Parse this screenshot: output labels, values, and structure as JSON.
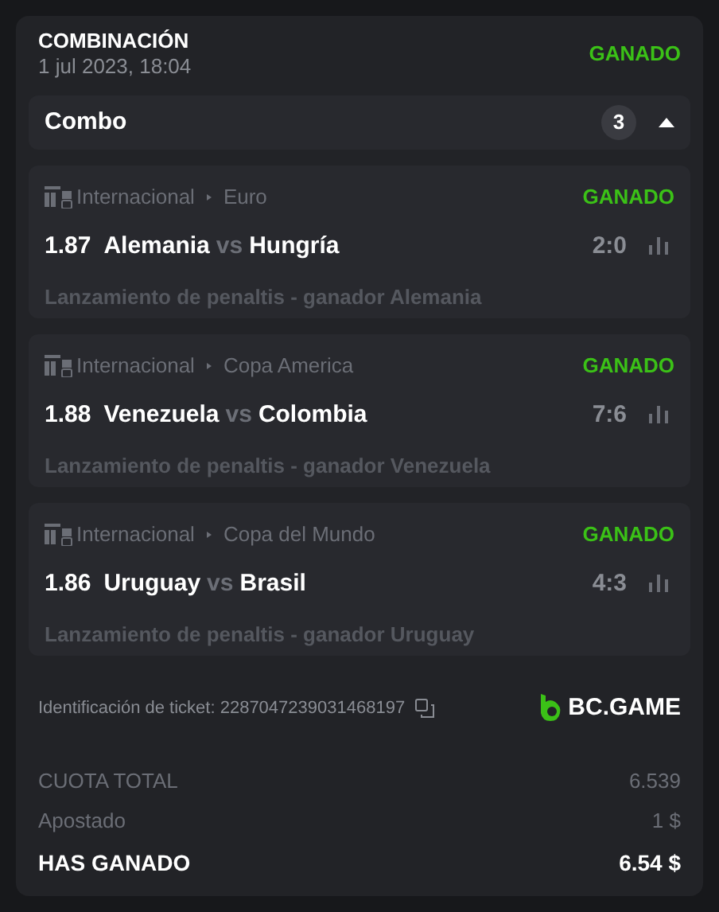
{
  "header": {
    "title": "COMBINACIÓN",
    "date": "1 jul 2023, 18:04",
    "status": "GANADO"
  },
  "combo": {
    "label": "Combo",
    "count": "3",
    "expanded": true
  },
  "selections": [
    {
      "category": "Internacional",
      "league": "Euro",
      "status": "GANADO",
      "odds": "1.87",
      "home": "Alemania",
      "vs": "vs",
      "away": "Hungría",
      "score": "2:0",
      "market": "Lanzamiento de penaltis - ganador Alemania"
    },
    {
      "category": "Internacional",
      "league": "Copa America",
      "status": "GANADO",
      "odds": "1.88",
      "home": "Venezuela",
      "vs": "vs",
      "away": "Colombia",
      "score": "7:6",
      "market": "Lanzamiento de penaltis - ganador Venezuela"
    },
    {
      "category": "Internacional",
      "league": "Copa del Mundo",
      "status": "GANADO",
      "odds": "1.86",
      "home": "Uruguay",
      "vs": "vs",
      "away": "Brasil",
      "score": "4:3",
      "market": "Lanzamiento de penaltis - ganador Uruguay"
    }
  ],
  "ticket": {
    "label": "Identificación de ticket: 2287047239031468197",
    "brand": "BC.GAME"
  },
  "summary": [
    {
      "kind": "muted",
      "label": "CUOTA TOTAL",
      "value": "6.539"
    },
    {
      "kind": "muted",
      "label": "Apostado",
      "value": "1 $"
    },
    {
      "kind": "total",
      "label": "HAS GANADO",
      "value": "6.54 $"
    }
  ]
}
